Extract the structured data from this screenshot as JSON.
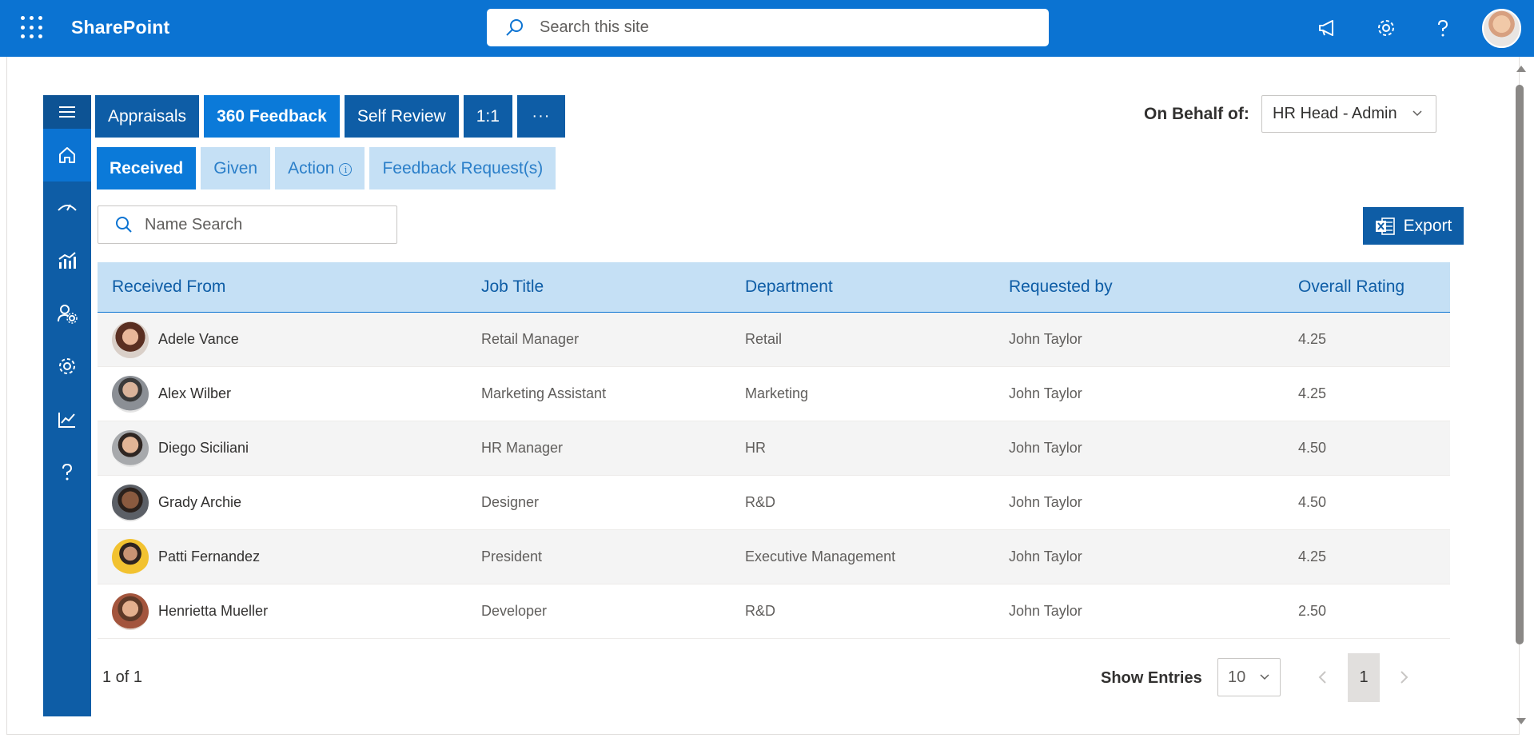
{
  "suite": {
    "brand": "SharePoint",
    "search_placeholder": "Search this site",
    "icons": [
      "waffle-icon",
      "megaphone-icon",
      "gear-icon",
      "help-icon",
      "user-avatar"
    ]
  },
  "rail": {
    "items": [
      {
        "icon": "hamburger-menu-icon"
      },
      {
        "icon": "home-icon",
        "active": true
      },
      {
        "icon": "gauge-icon"
      },
      {
        "icon": "analytics-chart-icon"
      },
      {
        "icon": "user-settings-icon"
      },
      {
        "icon": "gear-icon"
      },
      {
        "icon": "trend-line-icon"
      },
      {
        "icon": "question-icon"
      }
    ]
  },
  "main_tabs": {
    "appraisals": "Appraisals",
    "feedback_360": "360 Feedback",
    "self_review": "Self Review",
    "one_on_one": "1:1",
    "more": "···",
    "active": "360 Feedback"
  },
  "sub_tabs": {
    "received": "Received",
    "given": "Given",
    "action": "Action",
    "action_info": "i",
    "feedback_requests": "Feedback Request(s)",
    "active": "Received"
  },
  "behalf": {
    "label": "On Behalf of:",
    "selected": "HR Head - Admin"
  },
  "name_search": {
    "placeholder": "Name Search"
  },
  "export": {
    "label": "Export"
  },
  "table": {
    "headers": {
      "received_from": "Received From",
      "job_title": "Job Title",
      "department": "Department",
      "requested_by": "Requested by",
      "overall_rating": "Overall Rating"
    },
    "rows": [
      {
        "name": "Adele Vance",
        "job_title": "Retail Manager",
        "department": "Retail",
        "requested_by": "John Taylor",
        "rating": "4.25"
      },
      {
        "name": "Alex Wilber",
        "job_title": "Marketing Assistant",
        "department": "Marketing",
        "requested_by": "John Taylor",
        "rating": "4.25"
      },
      {
        "name": "Diego Siciliani",
        "job_title": "HR Manager",
        "department": "HR",
        "requested_by": "John Taylor",
        "rating": "4.50"
      },
      {
        "name": "Grady Archie",
        "job_title": "Designer",
        "department": "R&D",
        "requested_by": "John Taylor",
        "rating": "4.50"
      },
      {
        "name": "Patti Fernandez",
        "job_title": "President",
        "department": "Executive Management",
        "requested_by": "John Taylor",
        "rating": "4.25"
      },
      {
        "name": "Henrietta Mueller",
        "job_title": "Developer",
        "department": "R&D",
        "requested_by": "John Taylor",
        "rating": "2.50"
      }
    ]
  },
  "footer": {
    "page_count": "1 of 1",
    "show_entries_label": "Show Entries",
    "entries_selected": "10",
    "current_page": "1"
  },
  "colors": {
    "brand_blue": "#0b73d2",
    "dark_blue": "#0e5da6",
    "light_blue": "#c5e0f5"
  }
}
